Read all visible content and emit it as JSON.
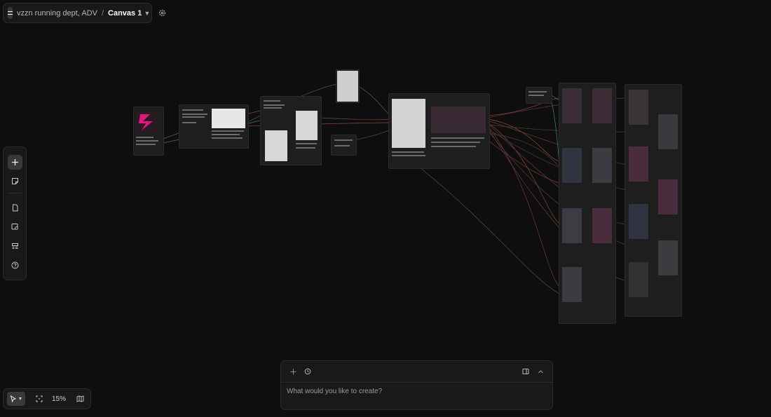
{
  "header": {
    "project": "vzzn running dept, ADV",
    "separator": "/",
    "canvas": "Canvas 1"
  },
  "toolbar_left": {
    "icons": [
      "plus-icon",
      "note-icon",
      "document-icon",
      "image-search-icon",
      "layout-icon",
      "help-icon"
    ]
  },
  "toolbar_bottom": {
    "zoom": "15%",
    "icons": [
      "cursor-icon",
      "fit-icon",
      "map-icon"
    ]
  },
  "prompt": {
    "placeholder": "What would you like to create?"
  },
  "colors": {
    "background": "#0f0e0f",
    "panel": "#1a191a",
    "accent": "#e0177e"
  }
}
